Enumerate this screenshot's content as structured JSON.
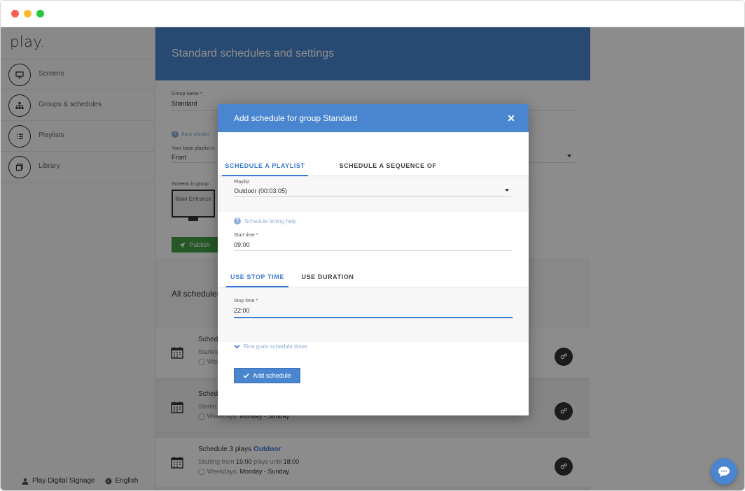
{
  "sidebar": {
    "logo": "play",
    "items": [
      {
        "label": "Screens",
        "icon": "monitor-icon"
      },
      {
        "label": "Groups & schedules",
        "icon": "hierarchy-icon"
      },
      {
        "label": "Playlists",
        "icon": "list-icon"
      },
      {
        "label": "Library",
        "icon": "library-icon"
      }
    ],
    "footer": {
      "account": "Play Digital Signage",
      "language": "English"
    }
  },
  "page": {
    "title": "Standard schedules and settings",
    "group_name_label": "Group name *",
    "group_name_value": "Standard",
    "base_playlist_help": "Base playlist",
    "base_playlist_label": "Your base playlist is",
    "base_playlist_value": "Front",
    "screens_in_group_label": "Screens in group",
    "screen_name": "Main Entrance",
    "publish_label": "Publish",
    "all_schedules_label": "All schedules",
    "schedules": [
      {
        "title_prefix": "Sched",
        "playlist": "",
        "starting": "Starting",
        "weekdays": "Week"
      },
      {
        "title_prefix": "Sched",
        "playlist": "",
        "starting": "Startin",
        "weekdays_label": "Weekdays",
        "weekdays_value": "Monday - Sunday"
      },
      {
        "title_prefix": "Schedule 3 plays",
        "playlist": "Outdoor",
        "starting_label": "Starting from",
        "start": "15:00",
        "plays_until": "plays until",
        "stop": "18:00",
        "weekdays_label": "Weekdays",
        "weekdays_value": "Monday - Sunday"
      }
    ]
  },
  "dialog": {
    "title": "Add schedule for group Standard",
    "tabs": [
      "SCHEDULE A PLAYLIST",
      "SCHEDULE A SEQUENCE OF PLAYLISTS"
    ],
    "playlist_label": "Playlist",
    "playlist_value": "Outdoor (00:03:05)",
    "timing_help": "Schedule timing help",
    "start_time_label": "Start time *",
    "start_time_value": "09:00",
    "stop_tabs": [
      "USE STOP TIME",
      "USE DURATION"
    ],
    "stop_time_label": "Stop time *",
    "stop_time_value": "22:00",
    "fine_grain_label": "Fine grain schedule times",
    "add_button_label": "Add schedule"
  },
  "colors": {
    "accent": "#4a86cf",
    "publish": "#43a047",
    "overlay": "rgba(0,0,0,0.45)"
  }
}
